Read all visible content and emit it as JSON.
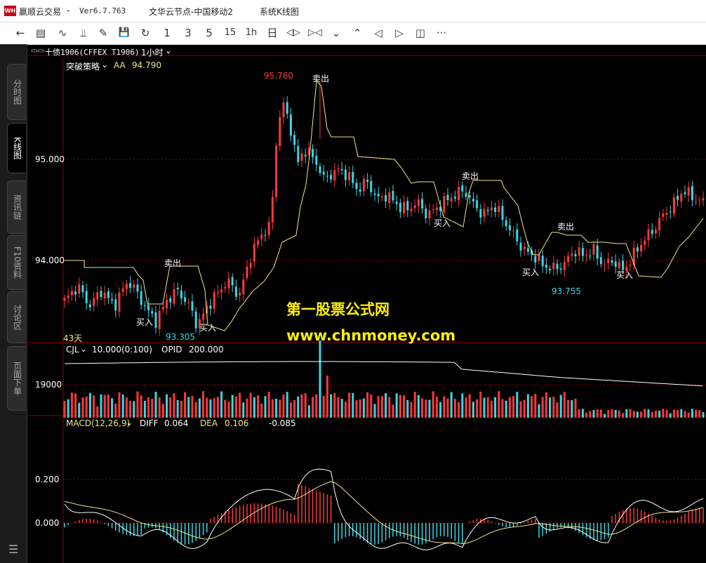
{
  "title_bar": {
    "app_name": "赢顺云交易",
    "separator": "-",
    "version": "Ver6.7.763",
    "server": "文华云节点-中国移动2",
    "window": "系统K线图",
    "logo_text": "WH"
  },
  "toolbar": {
    "items": [
      {
        "label": "←",
        "icon": "back-arrow-icon"
      },
      {
        "label": "▤",
        "icon": "list-icon"
      },
      {
        "label": "∿",
        "icon": "line-chart-icon"
      },
      {
        "label": "⫫",
        "icon": "candlestick-icon"
      },
      {
        "label": "✎",
        "icon": "draw-icon"
      },
      {
        "label": "💾",
        "icon": "save-icon"
      },
      {
        "label": "↻",
        "icon": "refresh-icon"
      },
      {
        "label": "1",
        "icon": "period-1-icon"
      },
      {
        "label": "3",
        "icon": "period-3-icon"
      },
      {
        "label": "5",
        "icon": "period-5-icon"
      },
      {
        "label": "15",
        "icon": "period-15-icon"
      },
      {
        "label": "1h",
        "icon": "period-1h-icon"
      },
      {
        "label": "日",
        "icon": "period-day-icon"
      },
      {
        "label": "◁▷",
        "icon": "zoom-out-icon"
      },
      {
        "label": "▷◁",
        "icon": "zoom-in-icon"
      },
      {
        "label": "⌄",
        "icon": "scroll-down-icon"
      },
      {
        "label": "⌃",
        "icon": "scroll-up-icon"
      },
      {
        "label": "◁",
        "icon": "move-left-icon"
      },
      {
        "label": "▷",
        "icon": "move-right-icon"
      },
      {
        "label": "◫",
        "icon": "layout-icon"
      },
      {
        "label": "···",
        "icon": "more-icon"
      }
    ]
  },
  "sidebar": {
    "tabs": [
      {
        "label": "分时图",
        "active": false
      },
      {
        "label": "K线图",
        "active": true
      },
      {
        "label": "资讯链",
        "active": false
      },
      {
        "label": "F10资料",
        "active": false
      },
      {
        "label": "讨论区",
        "active": false
      },
      {
        "label": "页面下单",
        "active": false
      }
    ],
    "menu_icon": "☰"
  },
  "chart_header": {
    "link_icon": "▭▭",
    "contract": "十债1906(CFFEX T1906)",
    "period": "1小时",
    "dropdown": "⌄"
  },
  "main_panel": {
    "indicator": "突破策略",
    "indicator_dropdown": "⌄",
    "aa_label": "AA",
    "aa_value": "94.790",
    "y_ticks": [
      "95.000",
      "94.000"
    ],
    "high_label": "95.760",
    "low_label_1": "93.305",
    "low_label_2": "93.755",
    "signals": [
      "卖出",
      "买入",
      "买入",
      "卖出",
      "卖出",
      "买入",
      "卖出",
      "买入",
      "买入"
    ],
    "days_label": "43天",
    "colors": {
      "up": "#ff3838",
      "down": "#38d8e8",
      "line": "#f0e68c",
      "grid": "#8b0000"
    }
  },
  "volume_panel": {
    "name": "CJL",
    "dropdown": "⌄",
    "params": "10.000(0:100)",
    "opid_label": "OPID",
    "opid_value": "200.000",
    "y_tick": "19000"
  },
  "macd_panel": {
    "name": "MACD(12,26,9)",
    "dropdown": "⌄",
    "diff_label": "DIFF",
    "diff_value": "0.064",
    "dea_label": "DEA",
    "dea_value": "0.106",
    "macd_value": "-0.085",
    "y_ticks": [
      "0.200",
      "0.000"
    ]
  },
  "watermark": {
    "line1": "第一股票公式网",
    "line2": "www.chnmoney.com"
  }
}
